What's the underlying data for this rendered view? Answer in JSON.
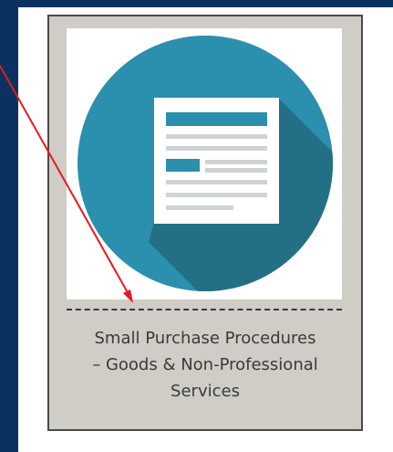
{
  "tile": {
    "icon": "document-icon",
    "caption_lines": [
      "Small Purchase Procedures",
      "– Goods & Non-Professional",
      "Services"
    ]
  },
  "annotation": {
    "type": "arrow",
    "color": "#e8191f"
  },
  "colors": {
    "sidebar": "#0b3160",
    "tile_background": "#cfcdc6",
    "circle": "#2b8fae",
    "long_shadow": "#236f86",
    "document_accent": "#2b8fae",
    "document_lines": "#cfd3d6"
  }
}
